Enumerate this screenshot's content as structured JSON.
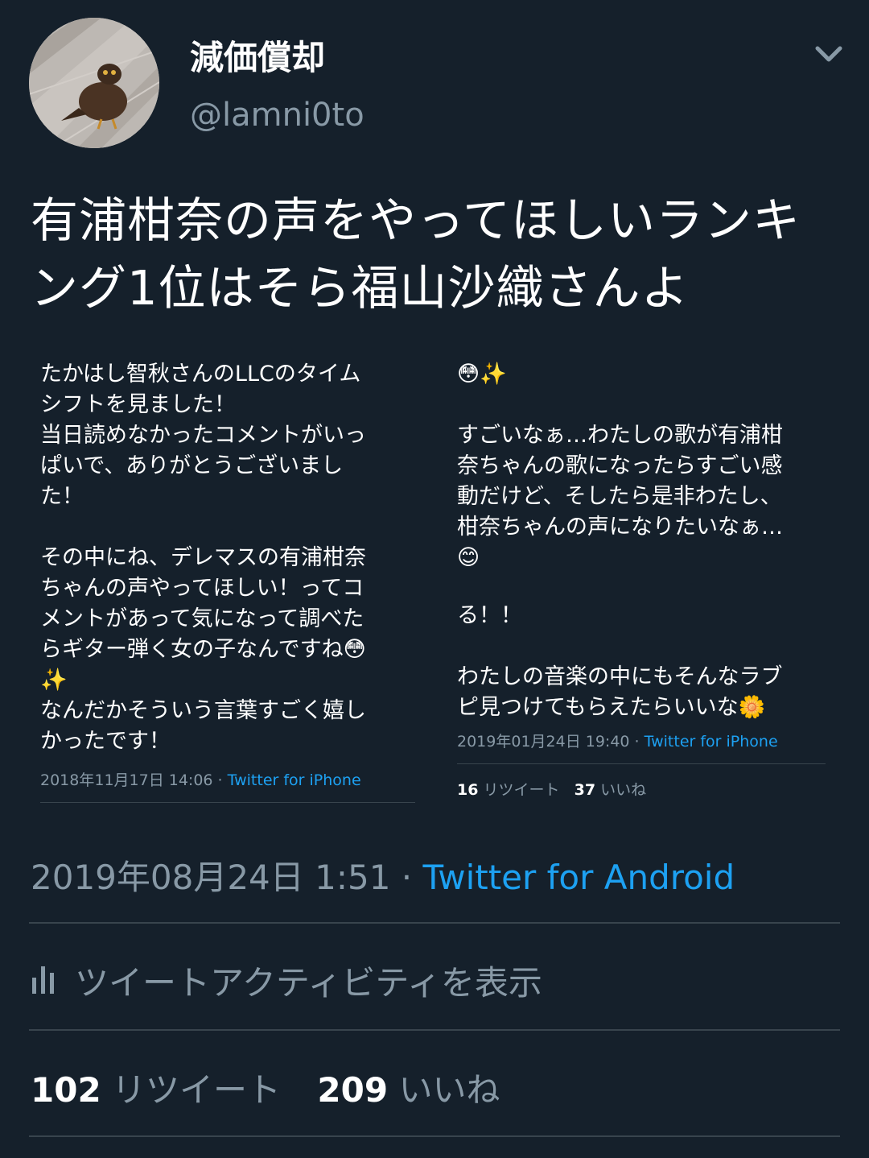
{
  "author": {
    "display_name": "減価償却",
    "handle": "@lamni0to",
    "avatar_icon": "owl-photo-avatar"
  },
  "tweet": {
    "text": "有浦柑奈の声をやってほしいランキング1位はそら福山沙織さんよ"
  },
  "screenshots": {
    "left": {
      "body": "たかはし智秋さんのLLCのタイム\nシフトを見ました！\n当日読めなかったコメントがいっ\nぱいで、ありがとうございまし\nた！\n\nその中にね、デレマスの有浦柑奈\nちゃんの声やってほしい！ってコ\nメントがあって気になって調べた\nらギター弾く女の子なんですね😳\n✨\nなんだかそういう言葉すごく嬉し\nかったです！",
      "date": "2018年11月17日 14:06",
      "separator": " · ",
      "source": "Twitter for iPhone"
    },
    "right": {
      "top_body": "😳✨\n\nすごいなぁ…わたしの歌が有浦柑\n奈ちゃんの歌になったらすごい感\n動だけど、そしたら是非わたし、\n柑奈ちゃんの声になりたいなぁ…\n😊",
      "bottom_body": "る！！\n\nわたしの音楽の中にもそんなラブ\nピ見つけてもらえたらいいな🌼",
      "date": "2019年01月24日 19:40",
      "separator": " · ",
      "source": "Twitter for iPhone",
      "retweets": "16",
      "retweets_label": "リツイート",
      "likes": "37",
      "likes_label": "いいね"
    }
  },
  "timestamp": {
    "date": "2019年08月24日 1:51",
    "separator": " · ",
    "client": "Twitter for Android"
  },
  "activity": {
    "label": "ツイートアクティビティを表示"
  },
  "stats": {
    "retweets": "102",
    "retweets_label": "リツイート",
    "likes": "209",
    "likes_label": "いいね"
  },
  "colors": {
    "background": "#15202b",
    "secondary_text": "#8899a6",
    "link": "#1da1f2",
    "divider": "#38444d"
  }
}
